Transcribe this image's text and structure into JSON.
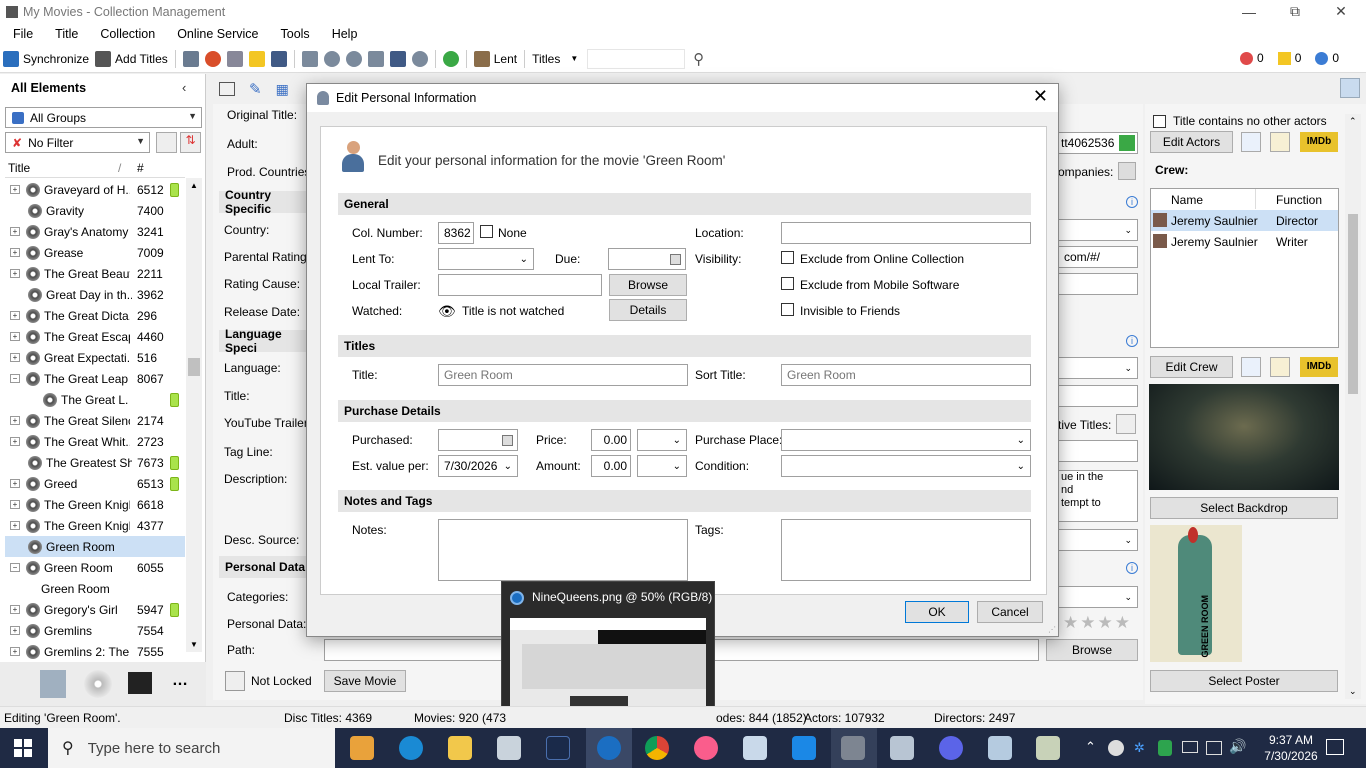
{
  "window": {
    "title": "My Movies - Collection Management"
  },
  "menu": [
    "File",
    "Title",
    "Collection",
    "Online Service",
    "Tools",
    "Help"
  ],
  "toolbar": {
    "synchronize": "Synchronize",
    "add_titles": "Add Titles",
    "lent": "Lent",
    "titles_dropdown": "Titles",
    "search_value": "",
    "err_count": "0",
    "warn_count": "0",
    "info_count": "0"
  },
  "sidebar": {
    "header": "All Elements",
    "group_filter": "All Groups",
    "filter": "No Filter",
    "col_title": "Title",
    "col_num": "#",
    "rows": [
      {
        "title": "Graveyard of H...",
        "num": "6512",
        "exp": "+",
        "bat": true
      },
      {
        "title": "Gravity",
        "num": "7400",
        "exp": "",
        "bat": false
      },
      {
        "title": "Gray's Anatomy",
        "num": "3241",
        "exp": "+",
        "bat": false
      },
      {
        "title": "Grease",
        "num": "7009",
        "exp": "+",
        "bat": false
      },
      {
        "title": "The Great Beauty",
        "num": "2211",
        "exp": "+",
        "bat": false
      },
      {
        "title": "Great Day in th...",
        "num": "3962",
        "exp": "",
        "bat": false
      },
      {
        "title": "The Great Dicta...",
        "num": "296",
        "exp": "+",
        "bat": false
      },
      {
        "title": "The Great Escape",
        "num": "4460",
        "exp": "+",
        "bat": false
      },
      {
        "title": "Great Expectati...",
        "num": "516",
        "exp": "+",
        "bat": false
      },
      {
        "title": "The Great Leap",
        "num": "8067",
        "exp": "−",
        "bat": false
      },
      {
        "title": "The Great L...",
        "num": "",
        "exp": "child",
        "bat": true
      },
      {
        "title": "The Great Silence",
        "num": "2174",
        "exp": "+",
        "bat": false
      },
      {
        "title": "The Great Whit...",
        "num": "2723",
        "exp": "+",
        "bat": false
      },
      {
        "title": "The Greatest Sh...",
        "num": "7673",
        "exp": "",
        "bat": true
      },
      {
        "title": "Greed",
        "num": "6513",
        "exp": "+",
        "bat": true
      },
      {
        "title": "The Green Knight",
        "num": "6618",
        "exp": "+",
        "bat": false
      },
      {
        "title": "The Green Knight",
        "num": "4377",
        "exp": "+",
        "bat": false
      },
      {
        "title": "Green Room",
        "num": "",
        "exp": "",
        "bat": false
      },
      {
        "title": "Green Room",
        "num": "6055",
        "exp": "−",
        "bat": false
      },
      {
        "title": "Green Room",
        "num": "",
        "exp": "childnd",
        "bat": false
      },
      {
        "title": "Gregory's Girl",
        "num": "5947",
        "exp": "+",
        "bat": true
      },
      {
        "title": "Gremlins",
        "num": "7554",
        "exp": "+",
        "bat": false
      },
      {
        "title": "Gremlins 2: The...",
        "num": "7555",
        "exp": "+",
        "bat": false
      }
    ]
  },
  "main": {
    "original_title": "Original Title:",
    "adult": "Adult:",
    "prod_countries": "Prod. Countries",
    "country_specific": "Country Specific",
    "country": "Country:",
    "parental_rating": "Parental Rating:",
    "rating_cause": "Rating Cause:",
    "release_date": "Release Date:",
    "language_specific": "Language Speci",
    "language": "Language:",
    "title": "Title:",
    "youtube": "YouTube Trailer",
    "tag_line": "Tag Line:",
    "description": "Description:",
    "desc_source": "Desc. Source:",
    "personal_data_head": "Personal Data",
    "categories": "Categories:",
    "personal_data": "Personal Data:",
    "path": "Path:",
    "browse": "Browse",
    "not_locked": "Not Locked",
    "save_movie": "Save Movie",
    "imdb_value": "tt4062536",
    "companies": "ompanies:",
    "url_value": "com/#/",
    "alt_titles": "tive Titles:",
    "desc_text": "ue in the\nnd\ntempt to"
  },
  "right": {
    "no_other_actors": "Title contains no other actors",
    "edit_actors": "Edit Actors",
    "crew_label": "Crew:",
    "crew_cols": [
      "Name",
      "Function"
    ],
    "crew": [
      {
        "name": "Jeremy Saulnier",
        "function": "Director"
      },
      {
        "name": "Jeremy Saulnier",
        "function": "Writer"
      }
    ],
    "edit_crew": "Edit Crew",
    "select_backdrop": "Select Backdrop",
    "select_poster": "Select Poster",
    "imdb": "IMDb",
    "poster_text": "GREEN ROOM"
  },
  "dialog": {
    "title": "Edit Personal Information",
    "heading": "Edit your personal information for the movie 'Green Room'",
    "general": "General",
    "col_number_label": "Col. Number:",
    "col_number": "8362",
    "none": "None",
    "location": "Location:",
    "lent_to": "Lent To:",
    "due": "Due:",
    "visibility": "Visibility:",
    "exclude_online": "Exclude from Online Collection",
    "local_trailer": "Local Trailer:",
    "browse": "Browse",
    "exclude_mobile": "Exclude from Mobile Software",
    "watched": "Watched:",
    "watched_status": "Title is not watched",
    "details": "Details",
    "invisible_friends": "Invisible to Friends",
    "titles_section": "Titles",
    "title_label": "Title:",
    "title_placeholder": "Green Room",
    "sort_title_label": "Sort Title:",
    "sort_title_placeholder": "Green Room",
    "purchase_section": "Purchase Details",
    "purchased": "Purchased:",
    "price": "Price:",
    "price_value": "0.00",
    "purchase_place": "Purchase Place:",
    "est_value": "Est. value per:",
    "est_date": "7/30/2026",
    "amount": "Amount:",
    "amount_value": "0.00",
    "condition": "Condition:",
    "notes_section": "Notes and Tags",
    "notes": "Notes:",
    "tags": "Tags:",
    "ok": "OK",
    "cancel": "Cancel"
  },
  "preview": {
    "title": "NineQueens.png @ 50% (RGB/8)"
  },
  "status": {
    "editing": "Editing 'Green Room'.",
    "disc_titles": "Disc Titles: 4369",
    "movies": "Movies: 920 (473",
    "episodes": "odes: 844 (1852)",
    "actors": "Actors: 107932",
    "directors": "Directors: 2497"
  },
  "taskbar": {
    "search_placeholder": "Type here to search",
    "time": "9:37 AM",
    "date": "7/30/2026"
  }
}
